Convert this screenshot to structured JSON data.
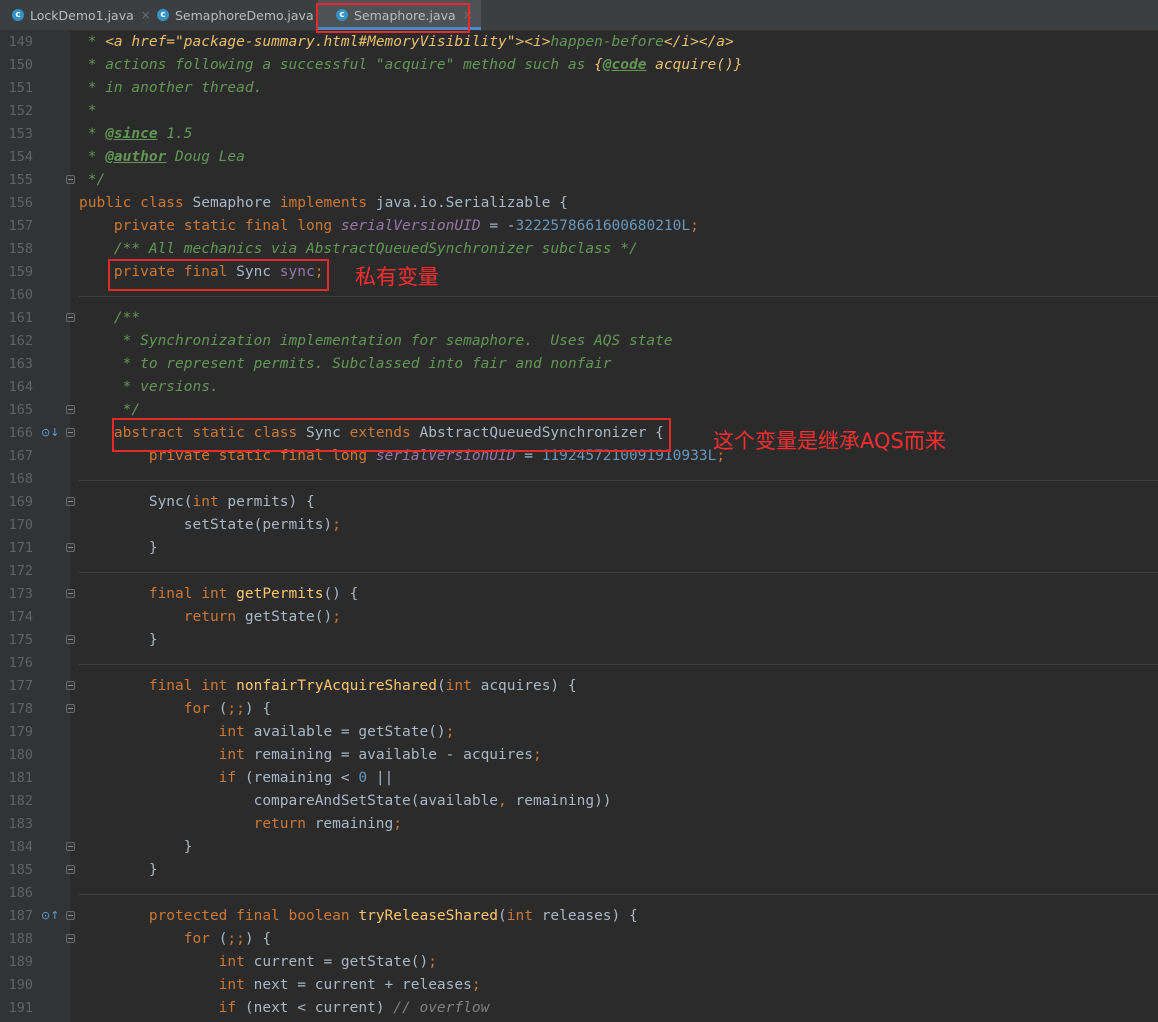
{
  "tabs": [
    {
      "label": "LockDemo1.java",
      "active": false
    },
    {
      "label": "SemaphoreDemo.java",
      "active": false
    },
    {
      "label": "Semaphore.java",
      "active": true
    }
  ],
  "annotations": {
    "sync_note": "私有变量",
    "aqs_note": "这个变量是继承AQS而来"
  },
  "colors": {
    "background": "#2b2b2b",
    "keyword": "#cc7832",
    "comment": "#629755",
    "number": "#6897bb",
    "field": "#9876aa",
    "method": "#ffc66d",
    "annotation_red": "#e62a2a"
  },
  "lines": [
    {
      "n": "149",
      "tokens": [
        {
          "t": " * ",
          "c": "cm"
        },
        {
          "t": "<a href=\"package-summary.html#MemoryVisibility\"><i>",
          "c": "tg"
        },
        {
          "t": "happen-before",
          "c": "cm"
        },
        {
          "t": "</i></a>",
          "c": "tg"
        }
      ]
    },
    {
      "n": "150",
      "tokens": [
        {
          "t": " * actions following a successful \"acquire\" method such as ",
          "c": "cm"
        },
        {
          "t": "{",
          "c": "tg"
        },
        {
          "t": "@code",
          "c": "tgu"
        },
        {
          "t": " acquire()}",
          "c": "tg"
        }
      ]
    },
    {
      "n": "151",
      "tokens": [
        {
          "t": " * in another thread.",
          "c": "cm"
        }
      ]
    },
    {
      "n": "152",
      "tokens": [
        {
          "t": " *",
          "c": "cm"
        }
      ]
    },
    {
      "n": "153",
      "tokens": [
        {
          "t": " * ",
          "c": "cm"
        },
        {
          "t": "@since",
          "c": "tgu"
        },
        {
          "t": " 1.5",
          "c": "cm"
        }
      ]
    },
    {
      "n": "154",
      "tokens": [
        {
          "t": " * ",
          "c": "cm"
        },
        {
          "t": "@author",
          "c": "tgu"
        },
        {
          "t": " Doug Lea",
          "c": "cm"
        }
      ]
    },
    {
      "n": "155",
      "tokens": [
        {
          "t": " */",
          "c": "cm"
        }
      ]
    },
    {
      "n": "156",
      "tokens": [
        {
          "t": "public class ",
          "c": "kw"
        },
        {
          "t": "Semaphore ",
          "c": ""
        },
        {
          "t": "implements ",
          "c": "kw"
        },
        {
          "t": "java.io.Serializable {",
          "c": ""
        }
      ]
    },
    {
      "n": "157",
      "tokens": [
        {
          "t": "    private static final long ",
          "c": "kw"
        },
        {
          "t": "serialVersionUID",
          "c": "fld"
        },
        {
          "t": " = -",
          "c": ""
        },
        {
          "t": "3222578661600680210L",
          "c": "num"
        },
        {
          "t": ";",
          "c": "kw"
        }
      ]
    },
    {
      "n": "158",
      "tokens": [
        {
          "t": "    /** All mechanics via AbstractQueuedSynchronizer subclass */",
          "c": "cm"
        }
      ]
    },
    {
      "n": "159",
      "tokens": [
        {
          "t": "    private final ",
          "c": "kw"
        },
        {
          "t": "Sync ",
          "c": ""
        },
        {
          "t": "sync",
          "c": "fldn"
        },
        {
          "t": ";",
          "c": "kw"
        }
      ]
    },
    {
      "n": "160",
      "tokens": []
    },
    {
      "n": "161",
      "tokens": [
        {
          "t": "    /**",
          "c": "cm"
        }
      ]
    },
    {
      "n": "162",
      "tokens": [
        {
          "t": "     * Synchronization implementation for semaphore.  Uses AQS state",
          "c": "cm"
        }
      ]
    },
    {
      "n": "163",
      "tokens": [
        {
          "t": "     * to represent permits. Subclassed into fair and nonfair",
          "c": "cm"
        }
      ]
    },
    {
      "n": "164",
      "tokens": [
        {
          "t": "     * versions.",
          "c": "cm"
        }
      ]
    },
    {
      "n": "165",
      "tokens": [
        {
          "t": "     */",
          "c": "cm"
        }
      ]
    },
    {
      "n": "166",
      "tokens": [
        {
          "t": "    abstract static class ",
          "c": "kw"
        },
        {
          "t": "Sync ",
          "c": ""
        },
        {
          "t": "extends ",
          "c": "kw"
        },
        {
          "t": "AbstractQueuedSynchronizer {",
          "c": ""
        }
      ]
    },
    {
      "n": "167",
      "tokens": [
        {
          "t": "        private static final long ",
          "c": "kw"
        },
        {
          "t": "serialVersionUID",
          "c": "fld"
        },
        {
          "t": " = ",
          "c": ""
        },
        {
          "t": "1192457210091910933L",
          "c": "num"
        },
        {
          "t": ";",
          "c": "kw"
        }
      ]
    },
    {
      "n": "168",
      "tokens": []
    },
    {
      "n": "169",
      "tokens": [
        {
          "t": "        Sync(",
          "c": ""
        },
        {
          "t": "int ",
          "c": "kw"
        },
        {
          "t": "permits) {",
          "c": ""
        }
      ]
    },
    {
      "n": "170",
      "tokens": [
        {
          "t": "            setState(permits)",
          "c": ""
        },
        {
          "t": ";",
          "c": "kw"
        }
      ]
    },
    {
      "n": "171",
      "tokens": [
        {
          "t": "        }",
          "c": ""
        }
      ]
    },
    {
      "n": "172",
      "tokens": []
    },
    {
      "n": "173",
      "tokens": [
        {
          "t": "        final int ",
          "c": "kw"
        },
        {
          "t": "getPermits",
          "c": "fn"
        },
        {
          "t": "() {",
          "c": ""
        }
      ]
    },
    {
      "n": "174",
      "tokens": [
        {
          "t": "            return ",
          "c": "kw"
        },
        {
          "t": "getState()",
          "c": ""
        },
        {
          "t": ";",
          "c": "kw"
        }
      ]
    },
    {
      "n": "175",
      "tokens": [
        {
          "t": "        }",
          "c": ""
        }
      ]
    },
    {
      "n": "176",
      "tokens": []
    },
    {
      "n": "177",
      "tokens": [
        {
          "t": "        final int ",
          "c": "kw"
        },
        {
          "t": "nonfairTryAcquireShared",
          "c": "fn"
        },
        {
          "t": "(",
          "c": ""
        },
        {
          "t": "int ",
          "c": "kw"
        },
        {
          "t": "acquires) {",
          "c": ""
        }
      ]
    },
    {
      "n": "178",
      "tokens": [
        {
          "t": "            for ",
          "c": "kw"
        },
        {
          "t": "(",
          "c": ""
        },
        {
          "t": ";;",
          "c": "kw"
        },
        {
          "t": ") {",
          "c": ""
        }
      ]
    },
    {
      "n": "179",
      "tokens": [
        {
          "t": "                int ",
          "c": "kw"
        },
        {
          "t": "available = getState()",
          "c": ""
        },
        {
          "t": ";",
          "c": "kw"
        }
      ]
    },
    {
      "n": "180",
      "tokens": [
        {
          "t": "                int ",
          "c": "kw"
        },
        {
          "t": "remaining = available - acquires",
          "c": ""
        },
        {
          "t": ";",
          "c": "kw"
        }
      ]
    },
    {
      "n": "181",
      "tokens": [
        {
          "t": "                if ",
          "c": "kw"
        },
        {
          "t": "(remaining < ",
          "c": ""
        },
        {
          "t": "0",
          "c": "num"
        },
        {
          "t": " ||",
          "c": ""
        }
      ]
    },
    {
      "n": "182",
      "tokens": [
        {
          "t": "                    compareAndSetState(available",
          "c": ""
        },
        {
          "t": ", ",
          "c": "kw"
        },
        {
          "t": "remaining))",
          "c": ""
        }
      ]
    },
    {
      "n": "183",
      "tokens": [
        {
          "t": "                    return ",
          "c": "kw"
        },
        {
          "t": "remaining",
          "c": ""
        },
        {
          "t": ";",
          "c": "kw"
        }
      ]
    },
    {
      "n": "184",
      "tokens": [
        {
          "t": "            }",
          "c": ""
        }
      ]
    },
    {
      "n": "185",
      "tokens": [
        {
          "t": "        }",
          "c": ""
        }
      ]
    },
    {
      "n": "186",
      "tokens": []
    },
    {
      "n": "187",
      "tokens": [
        {
          "t": "        protected final boolean ",
          "c": "kw"
        },
        {
          "t": "tryReleaseShared",
          "c": "fn"
        },
        {
          "t": "(",
          "c": ""
        },
        {
          "t": "int ",
          "c": "kw"
        },
        {
          "t": "releases) {",
          "c": ""
        }
      ]
    },
    {
      "n": "188",
      "tokens": [
        {
          "t": "            for ",
          "c": "kw"
        },
        {
          "t": "(",
          "c": ""
        },
        {
          "t": ";;",
          "c": "kw"
        },
        {
          "t": ") {",
          "c": ""
        }
      ]
    },
    {
      "n": "189",
      "tokens": [
        {
          "t": "                int ",
          "c": "kw"
        },
        {
          "t": "current = getState()",
          "c": ""
        },
        {
          "t": ";",
          "c": "kw"
        }
      ]
    },
    {
      "n": "190",
      "tokens": [
        {
          "t": "                int ",
          "c": "kw"
        },
        {
          "t": "next = current + releases",
          "c": ""
        },
        {
          "t": ";",
          "c": "kw"
        }
      ]
    },
    {
      "n": "191",
      "tokens": [
        {
          "t": "                if ",
          "c": "kw"
        },
        {
          "t": "(next < current) ",
          "c": ""
        },
        {
          "t": "// overflow",
          "c": "gray"
        }
      ]
    }
  ]
}
